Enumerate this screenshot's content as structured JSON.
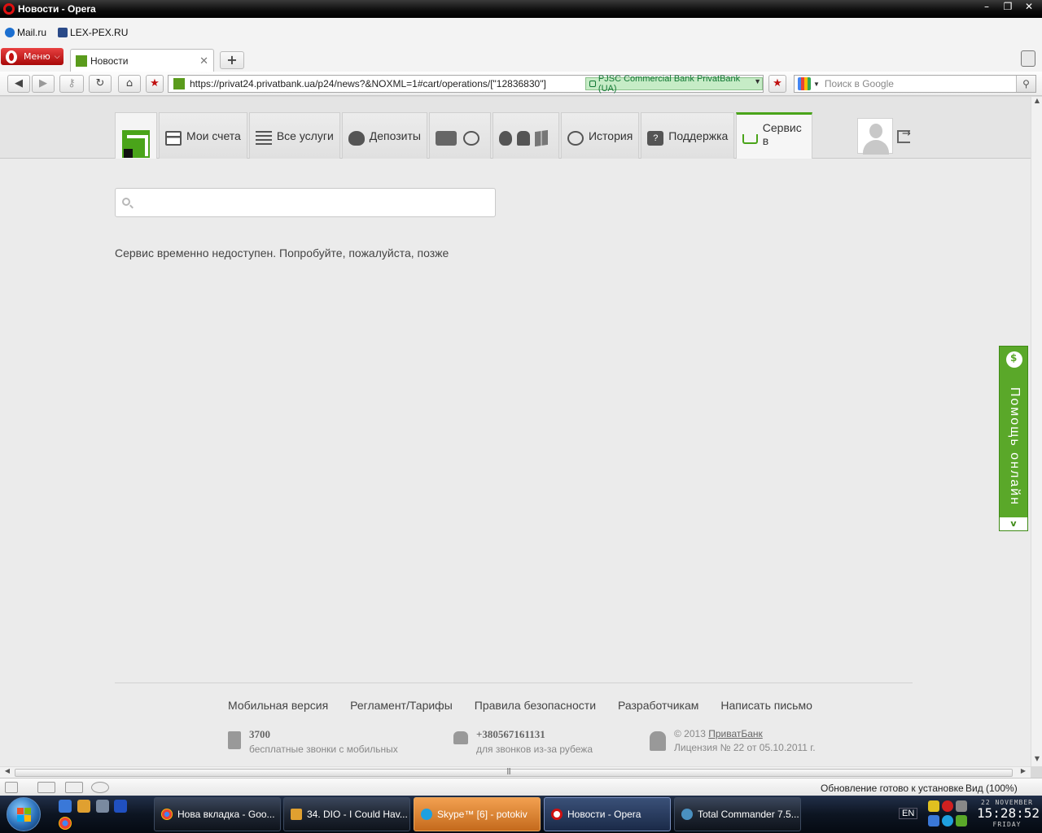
{
  "window": {
    "title": "Новости - Opera",
    "controls": [
      "–",
      "❐",
      "✕"
    ]
  },
  "bookmarks": [
    {
      "label": "Mail.ru",
      "icon": "mailru-icon"
    },
    {
      "label": "LEX-PEX.RU",
      "icon": "bookmark-star-icon"
    }
  ],
  "tabs": {
    "menu_label": "Меню",
    "active_tab": "Новости",
    "close": "✕",
    "new_tab": "+"
  },
  "toolbar": {
    "url": "https://privat24.privatbank.ua/p24/news?&NOXML=1#cart/operations/[\"12836830\"]",
    "cert_label": "PJSC Commercial Bank PrivatBank (UA)",
    "search_placeholder": "Поиск в Google"
  },
  "site": {
    "nav": [
      {
        "label": "Мои счета",
        "icon": "card-icon"
      },
      {
        "label": "Все услуги",
        "icon": "list-icon"
      },
      {
        "label": "Депозиты",
        "icon": "piggy-bank-icon"
      },
      {
        "label": "",
        "icon": "travel-sport-icon"
      },
      {
        "label": "",
        "icon": "mobile-platforms-icon"
      },
      {
        "label": "История",
        "icon": "history-icon"
      },
      {
        "label": "Поддержка",
        "icon": "support-icon"
      },
      {
        "label": "Сервис в",
        "icon": "cart-icon"
      }
    ],
    "message": "Сервис временно недоступен. Попробуйте, пожалуйста, позже",
    "help_tab": "Помощь онлайн",
    "help_arrow": "v"
  },
  "footer": {
    "links": [
      "Мобильная версия",
      "Регламент/Тарифы",
      "Правила безопасности",
      "Разработчикам",
      "Написать письмо"
    ],
    "phone_short": "3700",
    "phone_short_desc": "бесплатные звонки с мобильных",
    "phone_intl": "+380567161131",
    "phone_intl_desc": "для звонков из-за рубежа",
    "copyright": "© 2013",
    "bank_link": "ПриватБанк",
    "license": "Лицензия № 22 от 05.10.2011 г."
  },
  "statusbar": {
    "update": "Обновление готово к установке",
    "zoom": "Вид (100%)"
  },
  "taskbar": {
    "tasks": [
      "Нова вкладка - Goo...",
      "34. DIO - I Could Hav...",
      "Skype™ [6] - potokiv",
      "Новости - Opera",
      "Total Commander 7.5..."
    ],
    "lang": "EN",
    "date": "22 NOVEMBER",
    "time": "15:28:52",
    "weekday": "FRIDAY"
  },
  "colors": {
    "brand_green": "#4aa41a",
    "opera_red": "#c01010"
  }
}
